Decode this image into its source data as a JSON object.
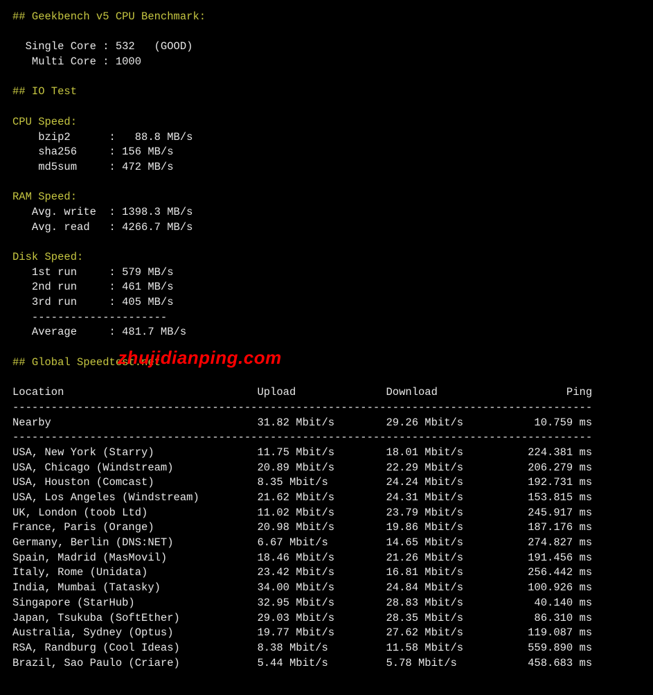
{
  "section_geekbench": "## Geekbench v5 CPU Benchmark:",
  "geekbench": {
    "single_label": "Single Core",
    "single_value": "532",
    "single_note": "(GOOD)",
    "multi_label": "Multi Core",
    "multi_value": "1000"
  },
  "section_io": "## IO Test",
  "cpu_speed_header": "CPU Speed:",
  "cpu_speed": [
    {
      "name": "bzip2",
      "value": "88.8 MB/s"
    },
    {
      "name": "sha256",
      "value": "156 MB/s"
    },
    {
      "name": "md5sum",
      "value": "472 MB/s"
    }
  ],
  "ram_speed_header": "RAM Speed:",
  "ram_speed": [
    {
      "name": "Avg. write",
      "value": "1398.3 MB/s"
    },
    {
      "name": "Avg. read",
      "value": "4266.7 MB/s"
    }
  ],
  "disk_speed_header": "Disk Speed:",
  "disk_speed": [
    {
      "name": "1st run",
      "value": "579 MB/s"
    },
    {
      "name": "2nd run",
      "value": "461 MB/s"
    },
    {
      "name": "3rd run",
      "value": "405 MB/s"
    }
  ],
  "disk_avg": {
    "name": "Average",
    "value": "481.7 MB/s"
  },
  "section_speedtest": "## Global Speedtest.net",
  "speedtest_headers": {
    "location": "Location",
    "upload": "Upload",
    "download": "Download",
    "ping": "Ping"
  },
  "nearby": {
    "location": "Nearby",
    "upload": "31.82 Mbit/s",
    "download": "29.26 Mbit/s",
    "ping": "10.759 ms"
  },
  "speedtest": [
    {
      "location": "USA, New York (Starry)",
      "upload": "11.75 Mbit/s",
      "download": "18.01 Mbit/s",
      "ping": "224.381 ms"
    },
    {
      "location": "USA, Chicago (Windstream)",
      "upload": "20.89 Mbit/s",
      "download": "22.29 Mbit/s",
      "ping": "206.279 ms"
    },
    {
      "location": "USA, Houston (Comcast)",
      "upload": "8.35 Mbit/s",
      "download": "24.24 Mbit/s",
      "ping": "192.731 ms"
    },
    {
      "location": "USA, Los Angeles (Windstream)",
      "upload": "21.62 Mbit/s",
      "download": "24.31 Mbit/s",
      "ping": "153.815 ms"
    },
    {
      "location": "UK, London (toob Ltd)",
      "upload": "11.02 Mbit/s",
      "download": "23.79 Mbit/s",
      "ping": "245.917 ms"
    },
    {
      "location": "France, Paris (Orange)",
      "upload": "20.98 Mbit/s",
      "download": "19.86 Mbit/s",
      "ping": "187.176 ms"
    },
    {
      "location": "Germany, Berlin (DNS:NET)",
      "upload": "6.67 Mbit/s",
      "download": "14.65 Mbit/s",
      "ping": "274.827 ms"
    },
    {
      "location": "Spain, Madrid (MasMovil)",
      "upload": "18.46 Mbit/s",
      "download": "21.26 Mbit/s",
      "ping": "191.456 ms"
    },
    {
      "location": "Italy, Rome (Unidata)",
      "upload": "23.42 Mbit/s",
      "download": "16.81 Mbit/s",
      "ping": "256.442 ms"
    },
    {
      "location": "India, Mumbai (Tatasky)",
      "upload": "34.00 Mbit/s",
      "download": "24.84 Mbit/s",
      "ping": "100.926 ms"
    },
    {
      "location": "Singapore (StarHub)",
      "upload": "32.95 Mbit/s",
      "download": "28.83 Mbit/s",
      "ping": "40.140 ms"
    },
    {
      "location": "Japan, Tsukuba (SoftEther)",
      "upload": "29.03 Mbit/s",
      "download": "28.35 Mbit/s",
      "ping": "86.310 ms"
    },
    {
      "location": "Australia, Sydney (Optus)",
      "upload": "19.77 Mbit/s",
      "download": "27.62 Mbit/s",
      "ping": "119.087 ms"
    },
    {
      "location": "RSA, Randburg (Cool Ideas)",
      "upload": "8.38 Mbit/s",
      "download": "11.58 Mbit/s",
      "ping": "559.890 ms"
    },
    {
      "location": "Brazil, Sao Paulo (Criare)",
      "upload": "5.44 Mbit/s",
      "download": "5.78 Mbit/s",
      "ping": "458.683 ms"
    }
  ],
  "watermark": "zhujidianping.com"
}
